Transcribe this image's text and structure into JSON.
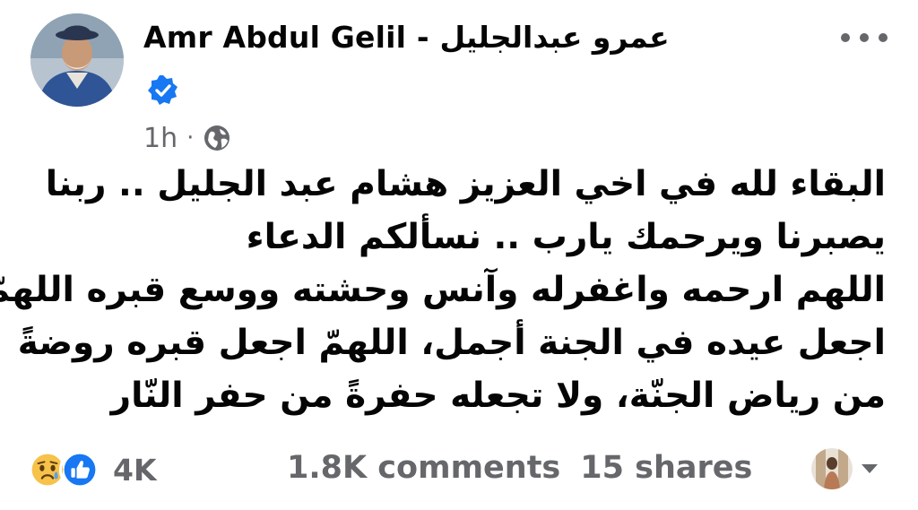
{
  "post": {
    "author_name": "Amr Abdul Gelil - عمرو عبدالجليل",
    "verified_icon": "verified-badge-icon",
    "timestamp": "1h",
    "separator": "·",
    "audience_icon": "globe-icon",
    "body_lines": [
      "البقاء لله في اخي العزيز هشام عبد الجليل .. ربنا",
      "يصبرنا ويرحمك يارب .. نسألكم الدعاء",
      "اللهم ارحمه واغفرله وآنس وحشته ووسع قبره اللهمّ",
      "اجعل عيده في الجنة أجمل، اللهمّ اجعل قبره روضةً",
      "من رياض الجنّة، ولا تجعله حفرةً من حفر النّار"
    ]
  },
  "footer": {
    "reaction_icons": [
      "sad-face-icon",
      "like-thumb-icon"
    ],
    "reaction_count": "4K",
    "comments": "1.8K comments",
    "shares": "15 shares"
  },
  "colors": {
    "text": "#050505",
    "secondary": "#65676b",
    "facebook_blue": "#1877f2",
    "sad_yellow": "#f7c24a"
  }
}
